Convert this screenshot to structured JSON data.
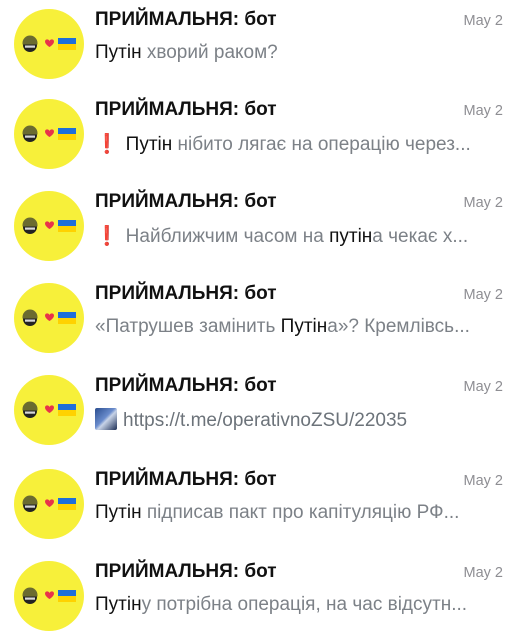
{
  "chats": [
    {
      "title": "ПРИЙМАЛЬНЯ: бот",
      "date": "May 2",
      "preview": {
        "hl1": "Путін",
        "rest": " хворий раком?"
      }
    },
    {
      "title": "ПРИЙМАЛЬНЯ: бот",
      "date": "May 2",
      "preview": {
        "hl1": "Путін",
        "rest": " нібито лягає на операцію через..."
      }
    },
    {
      "title": "ПРИЙМАЛЬНЯ: бот",
      "date": "May 2",
      "preview": {
        "pre": "Найближчим часом на ",
        "hl1": "путін",
        "rest": "а чекає х..."
      }
    },
    {
      "title": "ПРИЙМАЛЬНЯ: бот",
      "date": "May 2",
      "preview": {
        "pre": "«Патрушев замінить ",
        "hl1": "Путін",
        "rest": "а»? Кремлівсь..."
      }
    },
    {
      "title": "ПРИЙМАЛЬНЯ: бот",
      "date": "May 2",
      "preview": {
        "link": "https://t.me/operativnoZSU/22035"
      }
    },
    {
      "title": "ПРИЙМАЛЬНЯ: бот",
      "date": "May 2",
      "preview": {
        "hl1": "Путін",
        "rest": " підписав пакт про капітуляцію РФ..."
      }
    },
    {
      "title": "ПРИЙМАЛЬНЯ: бот",
      "date": "May 2",
      "preview": {
        "hl1": "Путін",
        "rest": "у потрібна операція, на час відсутн..."
      }
    }
  ],
  "icons": {
    "avatar_bg": "#f7f03a",
    "warning_glyph": "❗",
    "warning_color": "#e0242b",
    "heart_color": "#e8334a",
    "flag_blue": "#1e6fd9",
    "flag_yellow": "#ffd200"
  }
}
